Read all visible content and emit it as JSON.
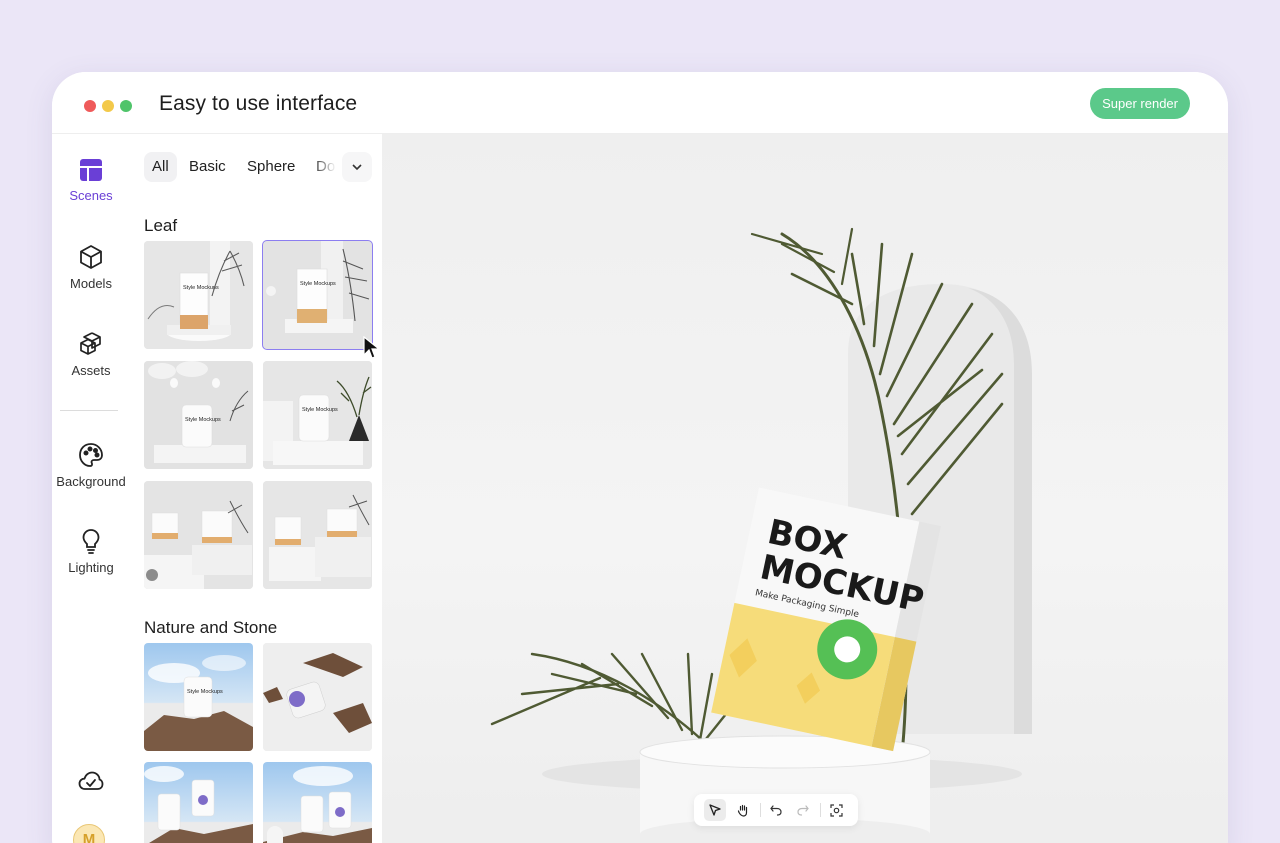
{
  "window": {
    "title": "Easy to use interface",
    "render_button": "Super render"
  },
  "rail": {
    "items": [
      {
        "label": "Scenes",
        "icon": "layout-icon",
        "active": true
      },
      {
        "label": "Models",
        "icon": "cube-icon",
        "active": false
      },
      {
        "label": "Assets",
        "icon": "boxes-icon",
        "active": false
      },
      {
        "label": "Background",
        "icon": "palette-icon",
        "active": false
      },
      {
        "label": "Lighting",
        "icon": "lightbulb-icon",
        "active": false
      }
    ],
    "bottom": {
      "cloud_icon": "cloud-sync-icon",
      "avatar_initial": "M"
    }
  },
  "panel": {
    "filters": [
      {
        "label": "All",
        "active": true
      },
      {
        "label": "Basic",
        "active": false
      },
      {
        "label": "Sphere",
        "active": false
      },
      {
        "label": "Do",
        "active": false
      }
    ],
    "sections": [
      {
        "title": "Leaf",
        "thumb_count": 6,
        "selected_index": 1
      },
      {
        "title": "Nature and Stone",
        "thumb_count": 4
      }
    ],
    "thumb_caption": "Style Mockups"
  },
  "canvas": {
    "box_title_line1": "BOX",
    "box_title_line2": "MOCKUP",
    "box_subtitle": "Make Packaging Simple",
    "toolbar": [
      {
        "icon": "pointer-icon",
        "active": true
      },
      {
        "icon": "hand-icon",
        "active": false
      },
      {
        "icon": "undo-icon",
        "active": false
      },
      {
        "icon": "redo-icon",
        "active": false
      },
      {
        "icon": "focus-icon",
        "active": false
      }
    ]
  },
  "colors": {
    "background": "#ebe6f7",
    "accent": "#6a3fd6",
    "render_button": "#5bc98a",
    "selection": "#8c7ef0",
    "box_yellow": "#f6dc7a",
    "badge_green": "#55c055"
  }
}
